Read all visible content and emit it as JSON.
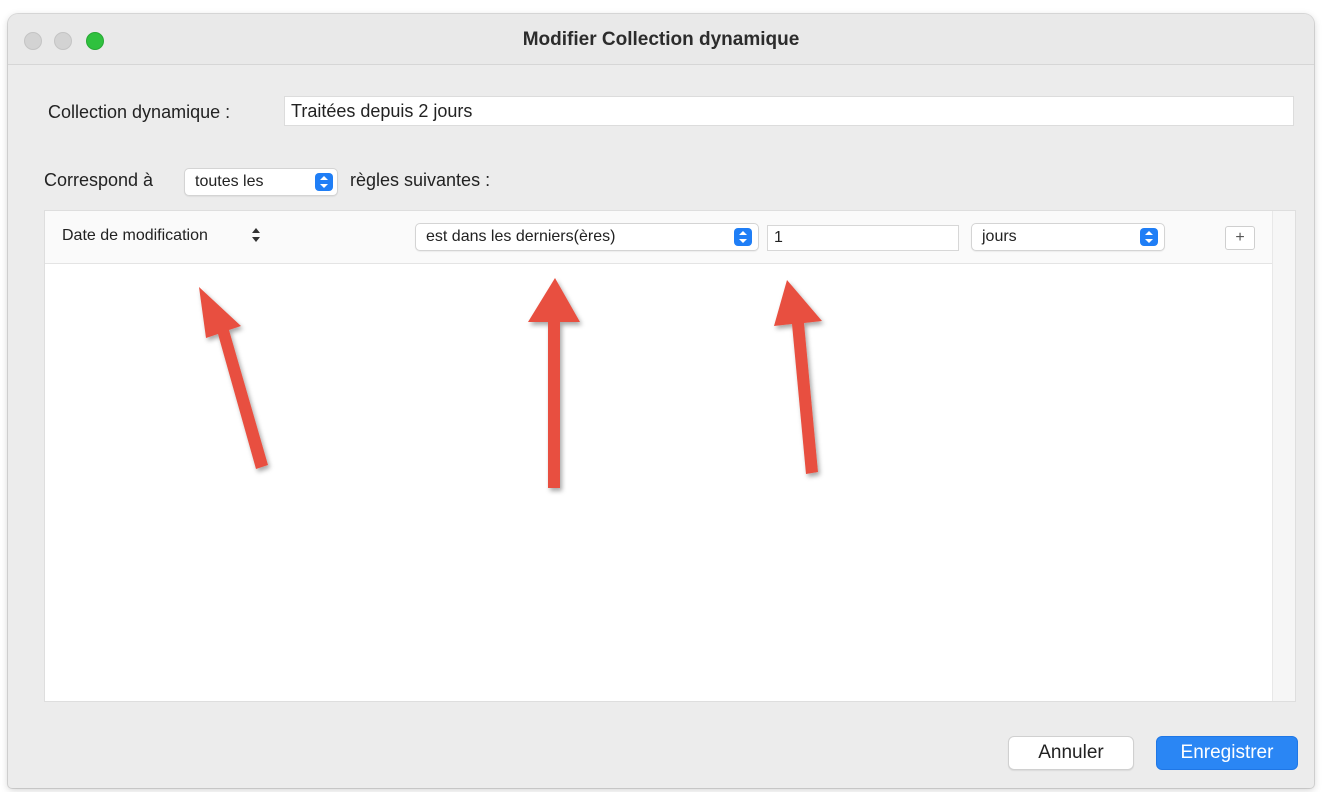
{
  "window": {
    "title": "Modifier Collection dynamique"
  },
  "collection": {
    "label": "Collection dynamique :",
    "value": "Traitées depuis 2 jours"
  },
  "match": {
    "prefix": "Correspond à",
    "selected": "toutes les",
    "suffix": "règles suivantes :"
  },
  "rule": {
    "field": "Date de modification",
    "operator": "est dans les derniers(ères)",
    "value": "1",
    "unit": "jours",
    "add_label": "+"
  },
  "buttons": {
    "cancel": "Annuler",
    "save": "Enregistrer"
  },
  "colors": {
    "accent": "#2a86f4",
    "annotation_arrow": "#e8503f",
    "traffic_zoom": "#2fc13e"
  }
}
